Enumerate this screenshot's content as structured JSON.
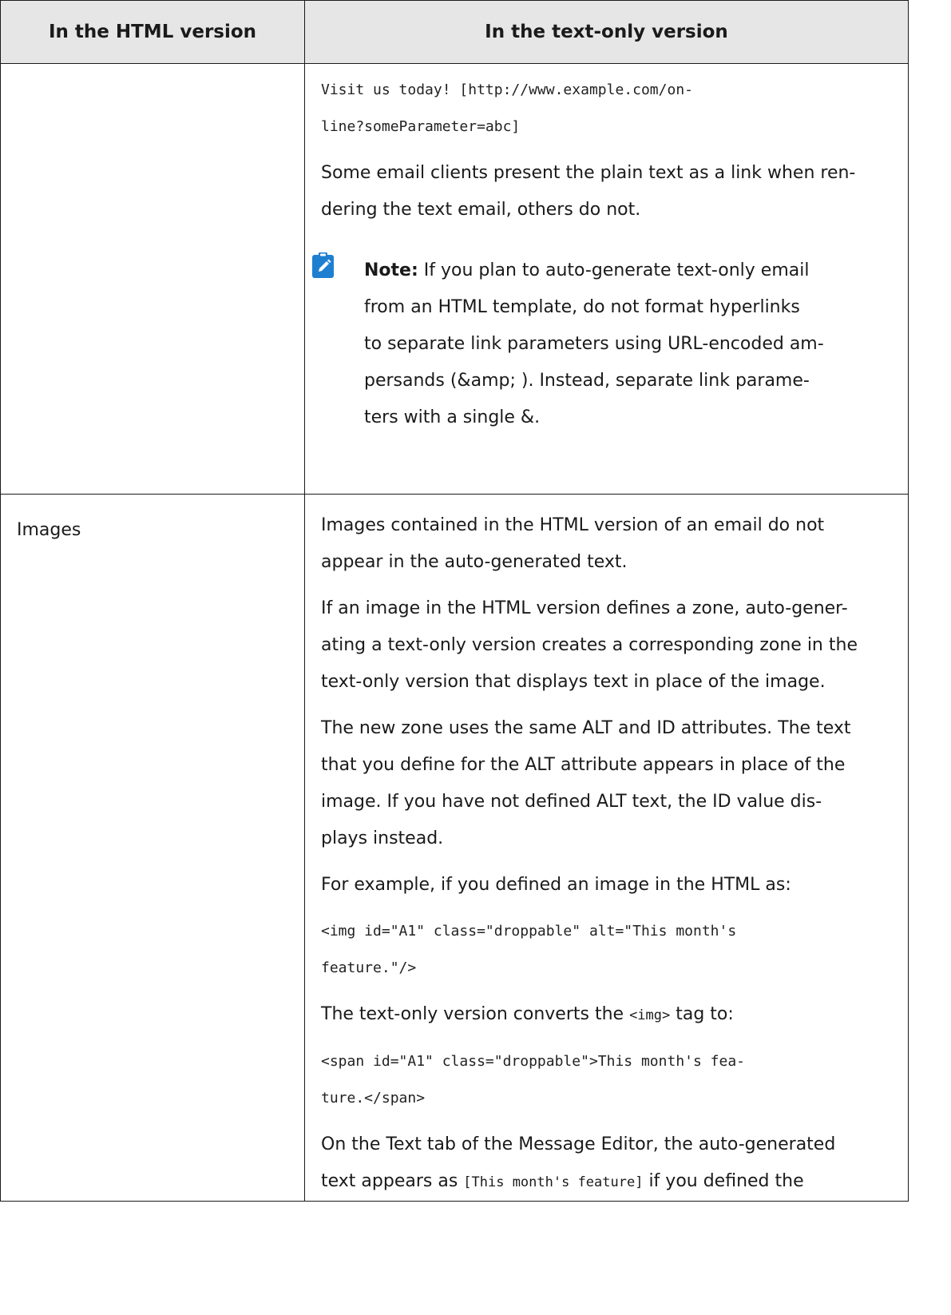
{
  "table": {
    "headers": [
      "In the HTML version",
      "In the text-only version"
    ],
    "row1": {
      "code_line1": "Visit us today! [http://www.example.com/on-",
      "code_line2": "line?someParameter=abc]",
      "para": [
        "Some email clients present the plain text as a link when ren-",
        "dering the text email, others do not."
      ],
      "note": {
        "icon": "note-pencil-icon",
        "label": "Note:",
        "line1_rest": " If you plan to auto-generate text-only email",
        "lines": [
          "from an HTML template, do not format hyperlinks",
          "to separate link parameters using URL-encoded am-",
          "persands (&amp; ). Instead, separate link parame-",
          "ters with a single &."
        ]
      }
    },
    "row2": {
      "label": "Images",
      "p1": [
        "Images contained in the HTML version of an email do not",
        "appear in the auto-generated text."
      ],
      "p2": [
        "If an image in the HTML version defines a zone, auto-gener-",
        "ating a text-only version creates a corresponding zone in the",
        "text-only version that displays text in place of the image."
      ],
      "p3": [
        "The new zone uses the same ALT and ID attributes. The text",
        "that you define for the ALT attribute appears in place of the",
        "image. If you have not defined ALT text, the ID value dis-",
        "plays instead."
      ],
      "p4": "For example, if you defined an image in the HTML as:",
      "code1": [
        "<img id=\"A1\" class=\"droppable\" alt=\"This month's",
        "feature.\"/>"
      ],
      "p5": {
        "before": "The text-only version converts the ",
        "code": "<img>",
        "after": " tag to:"
      },
      "code2": [
        "<span id=\"A1\" class=\"droppable\">This month's fea-",
        "ture.</span>"
      ],
      "p6_line1": "On the Text tab of the Message Editor, the auto-generated",
      "p6_line2": {
        "before": "text appears as ",
        "code": "[This month's feature]",
        "after": " if you defined the"
      }
    }
  }
}
